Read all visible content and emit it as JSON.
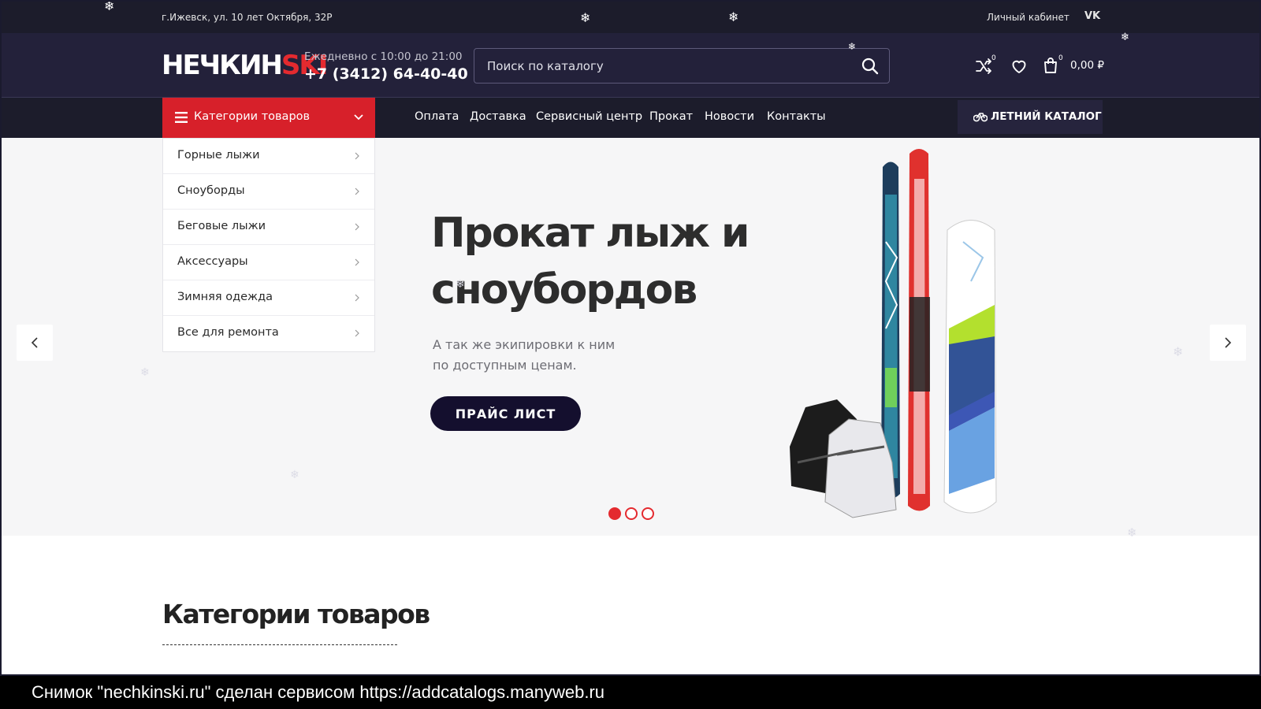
{
  "topbar": {
    "address": "г.Ижевск, ул. 10 лет Октября, 32Р",
    "cabinet": "Личный кабинет",
    "vk": "VK"
  },
  "header": {
    "logo_main": "НЕЧКИН",
    "logo_accent": "SKI",
    "hours": "Ежедневно с 10:00 до 21:00",
    "phone": "+7 (3412) 64-40-40",
    "search_placeholder": "Поиск по каталогу",
    "compare_count": "0",
    "cart_count": "0",
    "cart_total": "0,00 ₽"
  },
  "nav": {
    "categories_label": "Категории товаров",
    "menu": [
      "Оплата",
      "Доставка",
      "Сервисный центр",
      "Прокат",
      "Новости",
      "Контакты"
    ],
    "summer_catalog": "ЛЕТНИЙ КАТАЛОГ"
  },
  "sidebar": {
    "items": [
      "Горные лыжи",
      "Сноуборды",
      "Беговые лыжи",
      "Аксессуары",
      "Зимняя одежда",
      "Все для ремонта"
    ]
  },
  "hero": {
    "title": "Прокат лыж и сноубордов",
    "subtitle": "А так же экипировки к ним по доступным ценам.",
    "button": "ПРАЙС ЛИСТ",
    "slides": 3,
    "active_slide": 1
  },
  "section": {
    "title": "Категории товаров"
  },
  "caption": "Снимок \"nechkinski.ru\" сделан сервисом https://addcatalogs.manyweb.ru"
}
